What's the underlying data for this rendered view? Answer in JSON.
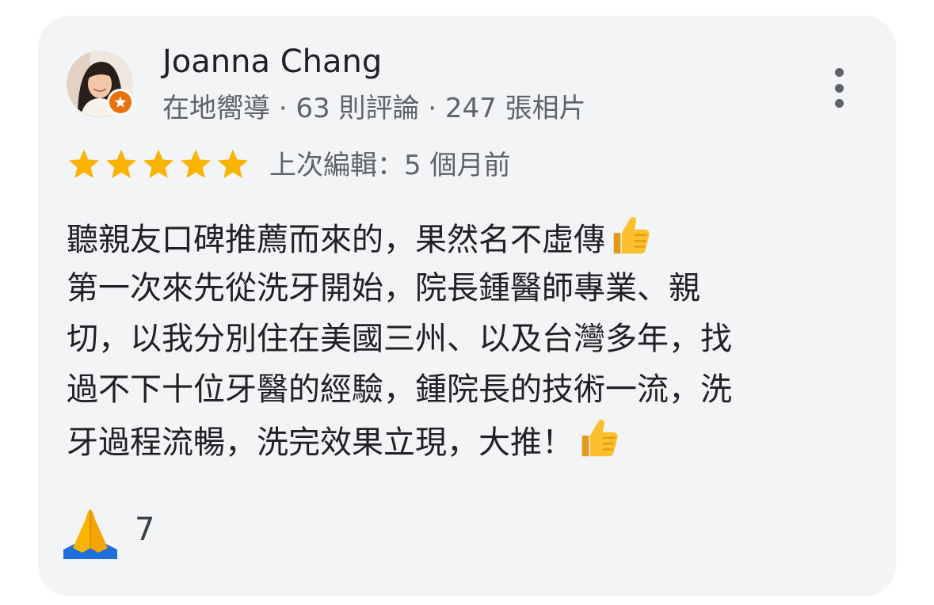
{
  "reviewer": {
    "name": "Joanna Chang",
    "meta": "在地嚮導 · 63 則評論 · 247 張相片"
  },
  "rating": {
    "stars": 5,
    "max": 5,
    "edited": "上次編輯：5 個月前"
  },
  "review": {
    "lines": [
      "聽親友口碑推薦而來的，果然名不虛傳",
      "第一次來先從洗牙開始，院長鍾醫師專業、親",
      "切，以我分別住在美國三州、以及台灣多年，找",
      "過不下十位牙醫的經驗，鍾院長的技術一流，洗",
      "牙過程流暢，洗完效果立現，大推！"
    ]
  },
  "reaction": {
    "icon": "folded-hands-icon",
    "count": "7"
  },
  "icons": {
    "avatar": "avatar",
    "badge": "local-guide-badge-icon",
    "more": "more-vert-icon",
    "star": "star-icon",
    "thumb": "thumbs-up-icon"
  },
  "colors": {
    "star": "#f9b300",
    "badge": "#e8710a",
    "card_bg": "#f3f4f6"
  }
}
